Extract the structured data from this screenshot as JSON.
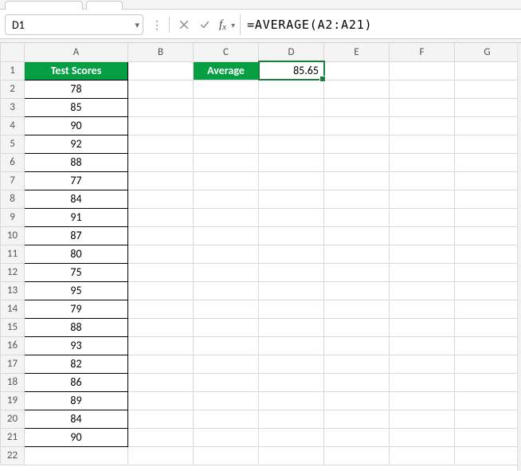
{
  "name_box": {
    "value": "D1"
  },
  "formula_bar": {
    "formula": "=AVERAGE(A2:A21)"
  },
  "columns": [
    "A",
    "B",
    "C",
    "D",
    "E",
    "F",
    "G"
  ],
  "rows": 22,
  "header_a": "Test Scores",
  "header_c": "Average",
  "value_d1": "85.65",
  "scores": [
    78,
    85,
    90,
    92,
    88,
    77,
    84,
    91,
    87,
    80,
    75,
    95,
    79,
    88,
    93,
    82,
    86,
    89,
    84,
    90
  ],
  "icons": {
    "dots": "⋮"
  },
  "chart_data": {
    "type": "table",
    "title": "Test Scores",
    "columns": [
      "Test Scores"
    ],
    "values": [
      78,
      85,
      90,
      92,
      88,
      77,
      84,
      91,
      87,
      80,
      75,
      95,
      79,
      88,
      93,
      82,
      86,
      89,
      84,
      90
    ],
    "derived": {
      "label": "Average",
      "value": 85.65,
      "formula": "=AVERAGE(A2:A21)"
    }
  }
}
